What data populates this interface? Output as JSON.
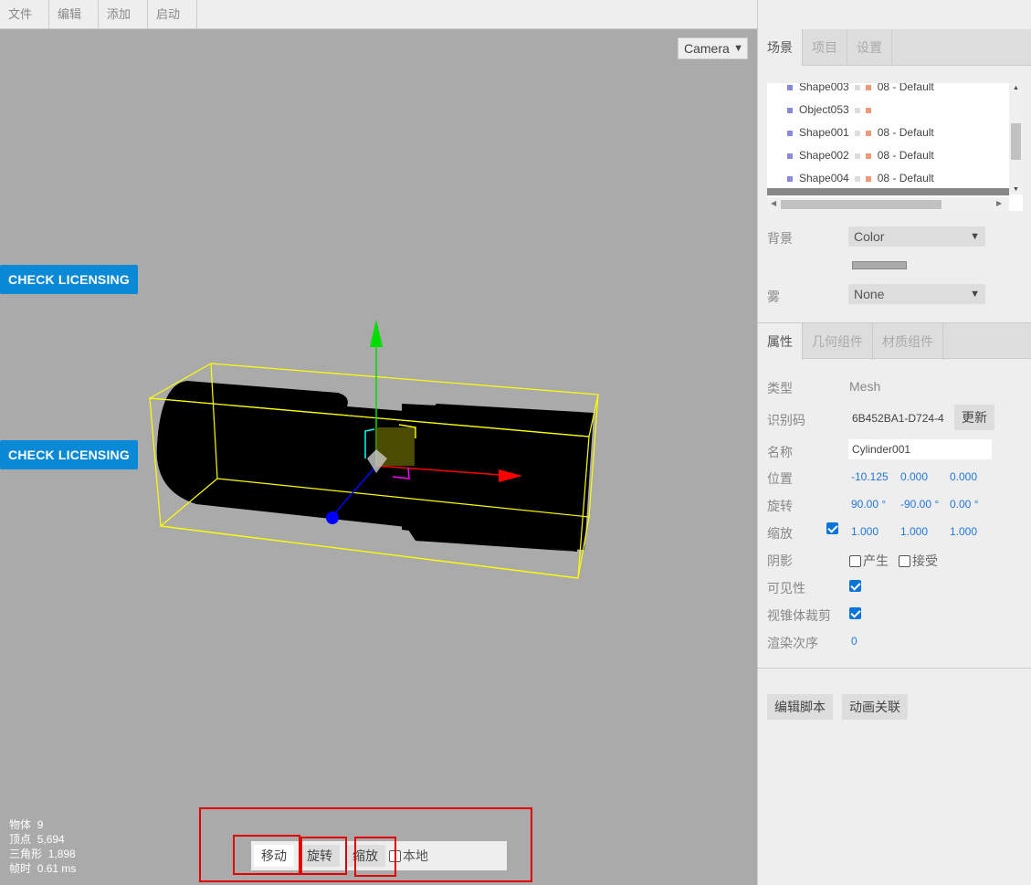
{
  "menubar": {
    "items": [
      "文件",
      "编辑",
      "添加",
      "启动"
    ]
  },
  "viewport": {
    "camera_select": "Camera",
    "license_button_1": "CHECK LICENSING",
    "license_button_2": "CHECK LICENSING",
    "stats": {
      "objects_label": "物体",
      "objects_value": "9",
      "vertices_label": "顶点",
      "vertices_value": "5,694",
      "triangles_label": "三角形",
      "triangles_value": "1,898",
      "frametime_label": "帧时",
      "frametime_value": "0.61 ms"
    },
    "toolbar": {
      "translate": "移动",
      "rotate": "旋转",
      "scale": "缩放",
      "local": "本地"
    }
  },
  "sidebar": {
    "top_tabs": [
      "场景",
      "项目",
      "设置"
    ],
    "outliner": [
      {
        "name": "Shape003",
        "material": "08 - Default"
      },
      {
        "name": "Object053",
        "material": ""
      },
      {
        "name": "Shape001",
        "material": "08 - Default"
      },
      {
        "name": "Shape002",
        "material": "08 - Default"
      },
      {
        "name": "Shape004",
        "material": "08 - Default"
      }
    ],
    "background_label": "背景",
    "background_value": "Color",
    "fog_label": "雾",
    "fog_value": "None",
    "prop_tabs": [
      "属性",
      "几何组件",
      "材质组件"
    ],
    "props": {
      "type_label": "类型",
      "type_value": "Mesh",
      "uuid_label": "识别码",
      "uuid_value": "6B452BA1-D724-4",
      "uuid_button": "更新",
      "name_label": "名称",
      "name_value": "Cylinder001",
      "position_label": "位置",
      "position": [
        "-10.125",
        "0.000",
        "0.000"
      ],
      "rotation_label": "旋转",
      "rotation": [
        "90.00 °",
        "-90.00 °",
        "0.00 °"
      ],
      "scale_label": "缩放",
      "scale": [
        "1.000",
        "1.000",
        "1.000"
      ],
      "shadow_label": "阴影",
      "shadow_cast": "产生",
      "shadow_receive": "接受",
      "visible_label": "可见性",
      "frustum_label": "视锥体裁剪",
      "render_order_label": "渲染次序",
      "render_order_value": "0"
    },
    "buttons": {
      "edit_script": "编辑脚本",
      "animation": "动画关联"
    }
  },
  "colors": {
    "accent": "#0a89d6",
    "viewport_bg": "#aaaaaa",
    "panel_bg": "#eeeeee",
    "highlight_box": "#e00000",
    "number_blue": "#2277dd"
  }
}
